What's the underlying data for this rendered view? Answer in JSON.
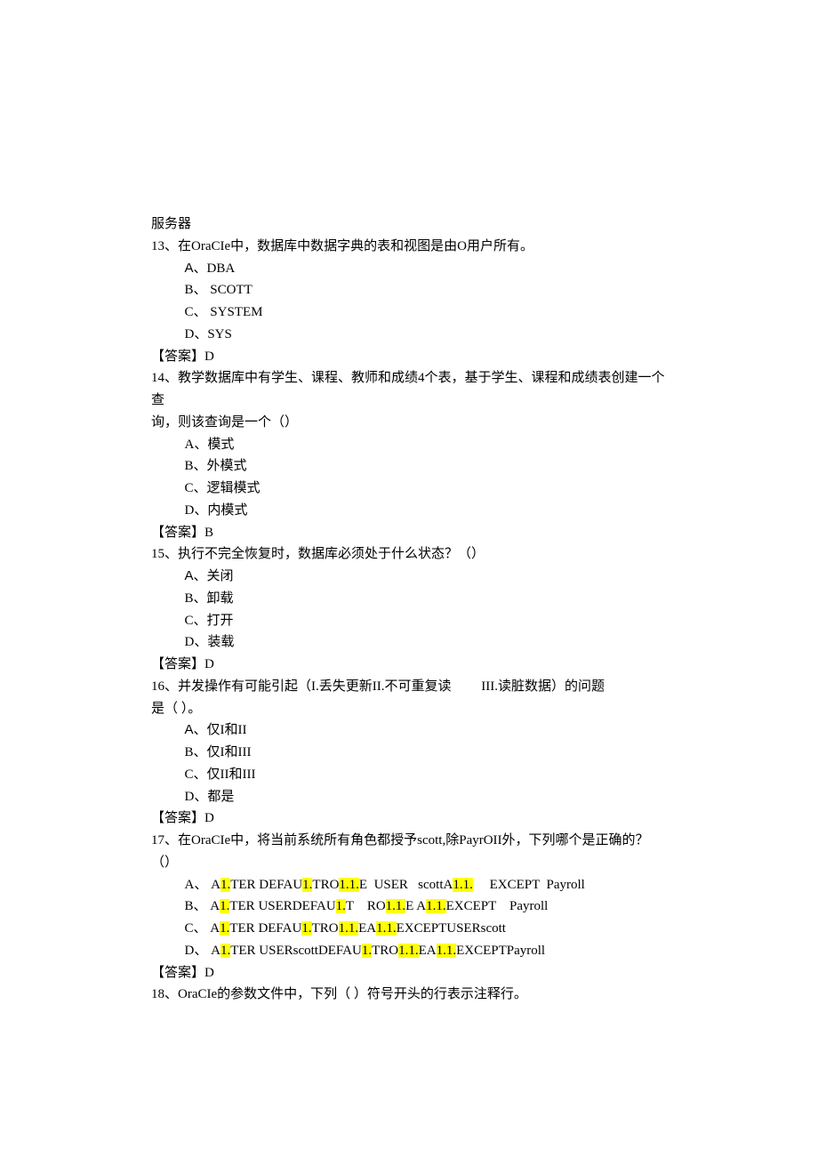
{
  "preText": "服务器",
  "q13": {
    "text": "13、在OraCIe中，数据库中数据字典的表和视图是由O用户所有。",
    "opts": {
      "A": {
        "label": "A",
        "text": "、DBA"
      },
      "B": {
        "label": "B、",
        "text": " SCOTT"
      },
      "C": {
        "label": "C、",
        "text": " SYSTEM"
      },
      "D": {
        "label": "D、",
        "text": "SYS"
      }
    },
    "ansLabel": "【答案】",
    "ans": "D"
  },
  "q14": {
    "text1": "14、教学数据库中有学生、课程、教师和成绩4个表，基于学生、课程和成绩表创建一个查",
    "text2": "询，则该查询是一个（）",
    "opts": {
      "A": {
        "label": "A、",
        "text": "模式"
      },
      "B": {
        "label": "B、",
        "text": "外模式"
      },
      "C": {
        "label": "C、",
        "text": "逻辑模式"
      },
      "D": {
        "label": "D、",
        "text": "内模式"
      }
    },
    "ansLabel": "【答案】",
    "ans": "B"
  },
  "q15": {
    "text": "15、执行不完全恢复时，数据库必须处于什么状态？（）",
    "opts": {
      "A": {
        "label": "A",
        "text": "、关闭"
      },
      "B": {
        "label": "B、",
        "text": "卸载"
      },
      "C": {
        "label": "C、",
        "text": "打开"
      },
      "D": {
        "label": "D、",
        "text": "装载"
      }
    },
    "ansLabel": "【答案】",
    "ans": "D"
  },
  "q16": {
    "text1a": "16、并发操作有可能引起（I.丢失更新II.不可重复读",
    "text1b": "III.读脏数据）的问题",
    "text2": "是（   ）。",
    "opts": {
      "A": {
        "label": "A",
        "text": "、仅I和II"
      },
      "B": {
        "label": "B、",
        "text": "仅I和III"
      },
      "C": {
        "label": "C、",
        "text": "仅II和III"
      },
      "D": {
        "label": "D、",
        "text": "都是"
      }
    },
    "ansLabel": "【答案】",
    "ans": "D"
  },
  "q17": {
    "text1": "17、在OraCIe中，将当前系统所有角色都授予scott,除PayrOII外，下列哪个是正确的？",
    "text2": "（）",
    "optA": {
      "label": "A、",
      "p0": " A",
      "h0": "1.",
      "p1": "TER DEFAU",
      "h1": "1.",
      "p2": "TRO",
      "h2": "1.1.",
      "p3": "E  USER   scottA",
      "h3": "1.1.",
      "p4": "     EXCEPT  Payroll"
    },
    "optB": {
      "label": "B、",
      "p0": " A",
      "h0": "1.",
      "p1": "TER USERDEFAU",
      "h1": "1.",
      "p2": "T    RO",
      "h2": "1.1.",
      "p3": "E A",
      "h3": "1.1.",
      "p4": "EXCEPT    Payroll"
    },
    "optC": {
      "label": "C、",
      "p0": " A",
      "h0": "1.",
      "p1": "TER DEFAU",
      "h1": "1.",
      "p2": "TRO",
      "h2": "1.1.",
      "p3": "EA",
      "h3": "1.1.",
      "p4": "EXCEPTUSERscott"
    },
    "optD": {
      "label": "D、",
      "p0": " A",
      "h0": "1.",
      "p1": "TER USERscottDEFAU",
      "h1": "1.",
      "p2": "TRO",
      "h2": "1.1.",
      "p3": "EA",
      "h3": "1.1.",
      "p4": "EXCEPTPayroll"
    },
    "ansLabel": "【答案】",
    "ans": "D"
  },
  "q18": {
    "text": "18、OraCIe的参数文件中，下列（     ）符号开头的行表示注释行。"
  }
}
